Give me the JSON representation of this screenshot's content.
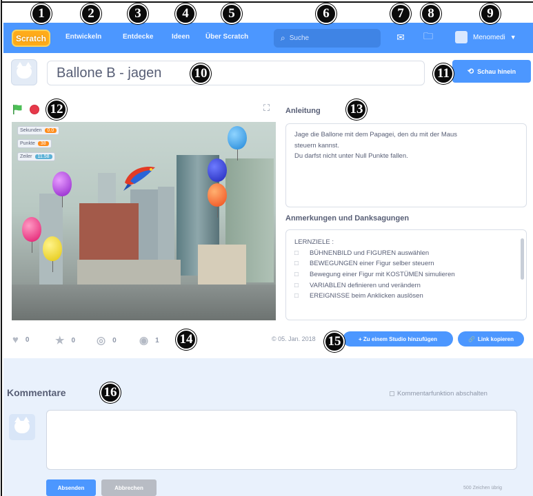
{
  "navbar": {
    "logo": "Scratch",
    "links": [
      "Entwickeln",
      "Entdecke",
      "Ideen",
      "Über Scratch"
    ],
    "search_placeholder": "Suche",
    "username": "Menomedi"
  },
  "project": {
    "title": "Ballone B - jagen",
    "see_inside_label": "Schau hinein"
  },
  "stage": {
    "monitors": [
      {
        "label": "Sekunden",
        "value": "0.0"
      },
      {
        "label": "Punkte",
        "value": "38"
      },
      {
        "label": "Zeiler",
        "value": "11.58"
      }
    ]
  },
  "instructions": {
    "title": "Anleitung",
    "lines": [
      "Jage die Ballone mit dem Papagei, den du mit der Maus",
      "steuern kannst.",
      "Du darfst nicht unter Null Punkte fallen."
    ]
  },
  "notes": {
    "title": "Anmerkungen und Danksagungen",
    "heading": "LERNZIELE :",
    "bullet": "□",
    "items": [
      "BÜHNENBILD und FIGUREN auswählen",
      "BEWEGUNGEN einer Figur selber steuern",
      "Bewegung einer Figur mit KOSTÜMEN simulieren",
      "VARIABLEN definieren und verändern",
      "EREIGNISSE beim Anklicken auslösen"
    ]
  },
  "stats": {
    "loves": "0",
    "favorites": "0",
    "remixes": "0",
    "views": "1"
  },
  "date": "© 05. Jan. 2018",
  "actions": {
    "add_to_studio": "+ Zu einem Studio hinzufügen",
    "copy_link": "Link kopieren"
  },
  "comments": {
    "title": "Kommentare",
    "toggle_label": "Kommentarfunktion abschalten",
    "post_label": "Absenden",
    "cancel_label": "Abbrechen",
    "chars_left": "500 Zeichen übrig"
  },
  "badges": [
    "1",
    "2",
    "3",
    "4",
    "5",
    "6",
    "7",
    "8",
    "9",
    "10",
    "11",
    "12",
    "13",
    "14",
    "15",
    "16"
  ],
  "colors": {
    "navbar": "#4c97ff",
    "logo": "#ffab19",
    "stop": "#e6394a",
    "flag": "#4cbf56",
    "comments_bg": "#e9f1fc"
  }
}
